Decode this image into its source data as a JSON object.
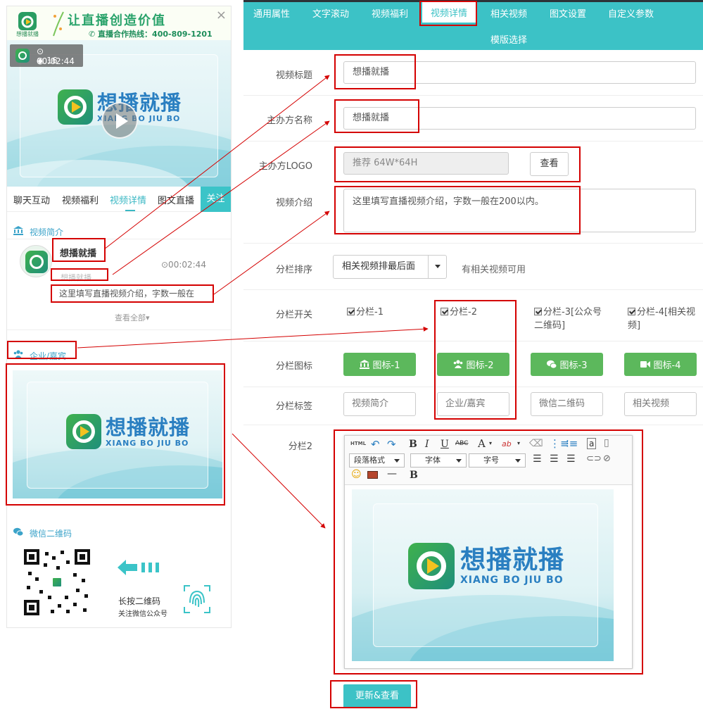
{
  "phone": {
    "banner": {
      "logo_text": "想播就播",
      "slogan": "让直播创造价值",
      "hotline": "直播合作热线：400-809-1201",
      "close": "×"
    },
    "video": {
      "duration": "00:02:44",
      "views": "16",
      "brand_cn": "想播就播",
      "brand_en": "XIANG BO JIU BO"
    },
    "tabs": [
      "聊天互动",
      "视频福利",
      "视频详情",
      "图文直播"
    ],
    "active_tab": "视频详情",
    "follow": "关注",
    "intro_section": {
      "title": "视频简介",
      "anchor_name": "想播就播",
      "organizer": "想播就播",
      "duration": "⊙00:02:44",
      "description": "这里填写直播视频介绍，字数一般在",
      "view_all": "查看全部▾"
    },
    "company_section": {
      "title": "企业/嘉宾",
      "brand_cn": "想播就播",
      "brand_en": "XIANG BO JIU BO"
    },
    "wechat_section": {
      "title": "微信二维码",
      "hint_main": "长按二维码",
      "hint_sub": "关注微信公众号"
    }
  },
  "settings": {
    "tabs_row1": [
      "通用属性",
      "文字滚动",
      "视频福利",
      "视频详情",
      "相关视频",
      "图文设置",
      "自定义参数"
    ],
    "tabs_row2": [
      "模版选择"
    ],
    "active_tab": "视频详情",
    "video_title": {
      "label": "视频标题",
      "value": "想播就播"
    },
    "host_name": {
      "label": "主办方名称",
      "value": "想播就播"
    },
    "host_logo": {
      "label": "主办方LOGO",
      "placeholder": "推荐 64W*64H",
      "button": "查看"
    },
    "video_intro": {
      "label": "视频介绍",
      "value": "这里填写直播视频介绍，字数一般在200以内。"
    },
    "column_order": {
      "label": "分栏排序",
      "selected": "相关视频排最后面",
      "hint": "有相关视频可用"
    },
    "column_switch": {
      "label": "分栏开关",
      "options": [
        "分栏-1",
        "分栏-2",
        "分栏-3[公众号二维码]",
        "分栏-4[相关视频]"
      ]
    },
    "column_icon": {
      "label": "分栏图标",
      "buttons": [
        "图标-1",
        "图标-2",
        "图标-3",
        "图标-4"
      ]
    },
    "column_tag": {
      "label": "分栏标签",
      "values": [
        "视频简介",
        "企业/嘉宾",
        "微信二维码",
        "相关视频"
      ]
    },
    "column2_editor": {
      "label": "分栏2",
      "toolbar_selects": [
        "段落格式",
        "字体",
        "字号"
      ],
      "brand_cn": "想播就播",
      "brand_en": "XIANG BO JIU BO"
    },
    "update_button": "更新&查看"
  },
  "colors": {
    "teal": "#3cc2c6",
    "green_button": "#5cb85c",
    "annotation_red": "#d40000",
    "brand_blue": "#2a7fc1",
    "brand_green": "#2aa36b"
  }
}
